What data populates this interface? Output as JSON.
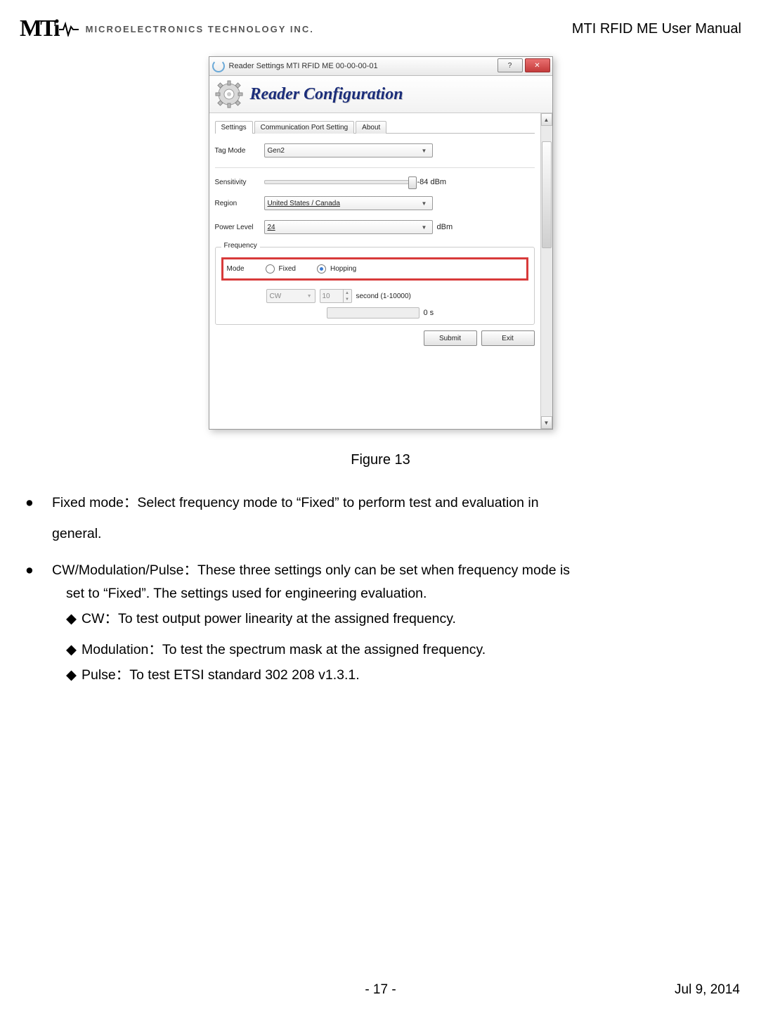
{
  "header": {
    "logo_text": "MTi",
    "logo_sub": "MICROELECTRONICS TECHNOLOGY INC.",
    "manual_title": "MTI RFID ME User Manual"
  },
  "window": {
    "title": "Reader Settings MTI RFID ME 00-00-00-01",
    "help_btn": "?",
    "close_btn": "✕",
    "banner_title": "Reader Configuration",
    "tabs": {
      "settings": "Settings",
      "comm": "Communication Port Setting",
      "about": "About"
    },
    "labels": {
      "tag_mode": "Tag Mode",
      "sensitivity": "Sensitivity",
      "region": "Region",
      "power_level": "Power Level",
      "dbm": "dBm",
      "sens_value": "-84 dBm",
      "frequency_legend": "Frequency",
      "mode": "Mode",
      "fixed": "Fixed",
      "hopping": "Hopping",
      "cw": "CW",
      "seconds_value": "10",
      "seconds_hint": "second (1-10000)",
      "progress_value": "0 s",
      "submit": "Submit",
      "exit": "Exit"
    },
    "values": {
      "tag_mode": "Gen2",
      "region": "United States / Canada",
      "power_level": "24"
    }
  },
  "caption": "Figure 13",
  "text": {
    "fixed_mode": "Fixed mode：Select frequency mode to “Fixed” to perform test and evaluation in",
    "fixed_mode_cont": "general.",
    "cwmod": "CW/Modulation/Pulse：These three settings only can be set when frequency mode is",
    "cwmod_cont": "set to “Fixed”. The settings used for engineering evaluation.",
    "cw": "CW：To test output power linearity at the assigned frequency.",
    "mod": "Modulation：To test the spectrum mask at the assigned frequency.",
    "pulse": "Pulse：To test ETSI standard 302 208 v1.3.1."
  },
  "footer": {
    "page": "-  17  -",
    "date": "Jul  9,  2014"
  }
}
